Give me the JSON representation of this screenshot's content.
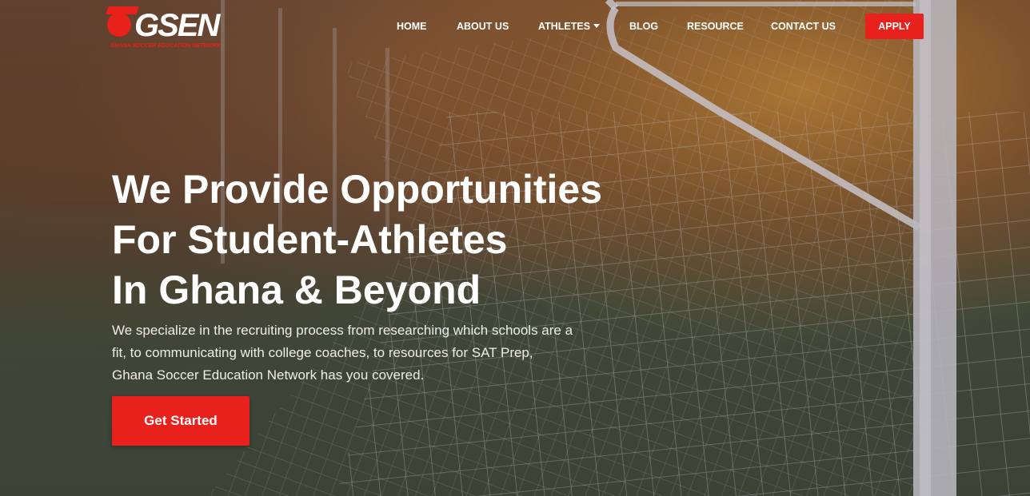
{
  "brand": {
    "logo_text": "GSEN",
    "tagline": "GHANA SOCCER EDUCATION NETWORK",
    "accent_color": "#e8211c"
  },
  "nav": {
    "items": [
      {
        "label": "HOME"
      },
      {
        "label": "ABOUT US"
      },
      {
        "label": "ATHLETES",
        "has_dropdown": true
      },
      {
        "label": "BLOG"
      },
      {
        "label": "RESOURCE"
      },
      {
        "label": "CONTACT US"
      }
    ],
    "apply_label": "APPLY"
  },
  "hero": {
    "headline_lines": [
      "We Provide Opportunities",
      "For Student-Athletes",
      "In Ghana & Beyond"
    ],
    "subtext": "We specialize in the recruiting process from researching which schools are a fit, to communicating with college coaches, to resources for SAT Prep, Ghana Soccer Education Network  has you covered.",
    "cta_label": "Get Started",
    "background_image": "soccer-goal-net-photo"
  }
}
